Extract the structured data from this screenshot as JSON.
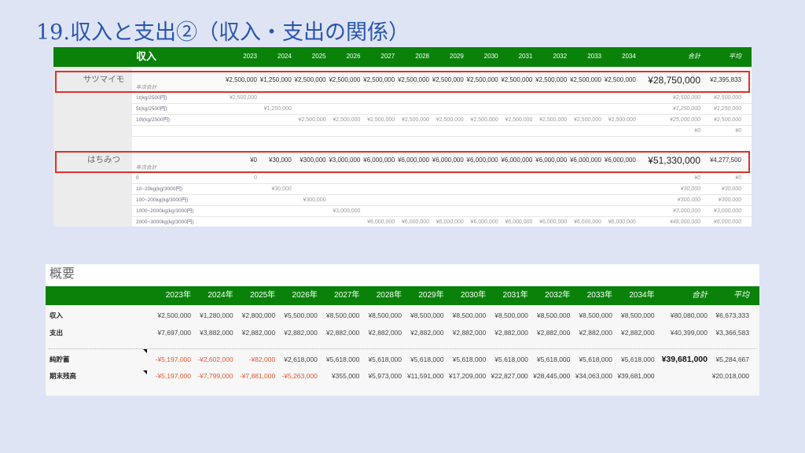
{
  "slide": {
    "title": "19.収入と支出②（収入・支出の関係）"
  },
  "colors": {
    "header_green": "#0a820a",
    "highlight_border": "#e0302a",
    "negative": "#e8582e",
    "title_blue": "#2856b0",
    "slide_background": "#dfe4f4"
  },
  "income_table": {
    "header_label": "収入",
    "years": [
      "2023",
      "2024",
      "2025",
      "2026",
      "2027",
      "2028",
      "2029",
      "2030",
      "2031",
      "2032",
      "2033",
      "2034"
    ],
    "total_label": "合計",
    "avg_label": "平均",
    "sections": [
      {
        "name": "サツマイモ",
        "summary": {
          "label": "年次合計",
          "values": [
            "¥2,500,000",
            "¥1,250,000",
            "¥2,500,000",
            "¥2,500,000",
            "¥2,500,000",
            "¥2,500,000",
            "¥2,500,000",
            "¥2,500,000",
            "¥2,500,000",
            "¥2,500,000",
            "¥2,500,000",
            "¥2,500,000"
          ],
          "total": "¥28,750,000",
          "avg": "¥2,395,833"
        },
        "rows": [
          {
            "label": "1t(kg/2500円)",
            "values": [
              "¥2,500,000",
              "",
              "",
              "",
              "",
              "",
              "",
              "",
              "",
              "",
              "",
              ""
            ],
            "total": "¥2,500,000",
            "avg": "¥2,500,000"
          },
          {
            "label": "5t(kg/2500円)",
            "values": [
              "",
              "¥1,250,000",
              "",
              "",
              "",
              "",
              "",
              "",
              "",
              "",
              "",
              ""
            ],
            "total": "¥1,250,000",
            "avg": "¥1,250,000"
          },
          {
            "label": "10t(kg/2500円)",
            "values": [
              "",
              "",
              "¥2,500,000",
              "¥2,500,000",
              "¥2,500,000",
              "¥2,500,000",
              "¥2,500,000",
              "¥2,500,000",
              "¥2,500,000",
              "¥2,500,000",
              "¥2,500,000",
              "¥2,500,000"
            ],
            "total": "¥25,000,000",
            "avg": "¥2,500,000"
          },
          {
            "label": "",
            "values": [
              "",
              "",
              "",
              "",
              "",
              "",
              "",
              "",
              "",
              "",
              "",
              ""
            ],
            "total": "¥0",
            "avg": "¥0"
          }
        ]
      },
      {
        "name": "はちみつ",
        "summary": {
          "label": "年次合計",
          "values": [
            "¥0",
            "¥30,000",
            "¥300,000",
            "¥3,000,000",
            "¥6,000,000",
            "¥6,000,000",
            "¥6,000,000",
            "¥6,000,000",
            "¥6,000,000",
            "¥6,000,000",
            "¥6,000,000",
            "¥6,000,000"
          ],
          "total": "¥51,330,000",
          "avg": "¥4,277,500"
        },
        "rows": [
          {
            "label": "0",
            "values": [
              "0",
              "",
              "",
              "",
              "",
              "",
              "",
              "",
              "",
              "",
              "",
              ""
            ],
            "total": "¥0",
            "avg": "¥0"
          },
          {
            "label": "10~20kg(kg/3000円)",
            "values": [
              "",
              "¥30,000",
              "",
              "",
              "",
              "",
              "",
              "",
              "",
              "",
              "",
              ""
            ],
            "total": "¥30,000",
            "avg": "¥30,000"
          },
          {
            "label": "100~200kg(kg/3000円)",
            "values": [
              "",
              "",
              "¥300,000",
              "",
              "",
              "",
              "",
              "",
              "",
              "",
              "",
              ""
            ],
            "total": "¥300,000",
            "avg": "¥300,000"
          },
          {
            "label": "1000~2000kg(kg/3000円)",
            "values": [
              "",
              "",
              "",
              "¥3,000,000",
              "",
              "",
              "",
              "",
              "",
              "",
              "",
              ""
            ],
            "total": "¥3,000,000",
            "avg": "¥3,000,000"
          },
          {
            "label": "2000~3000kg(kg/3000円)",
            "values": [
              "",
              "",
              "",
              "",
              "¥6,000,000",
              "¥6,000,000",
              "¥6,000,000",
              "¥6,000,000",
              "¥6,000,000",
              "¥6,000,000",
              "¥6,000,000",
              "¥6,000,000"
            ],
            "total": "¥48,000,000",
            "avg": "¥6,000,000"
          }
        ]
      }
    ]
  },
  "summary_table": {
    "title": "概要",
    "years": [
      "2023年",
      "2024年",
      "2025年",
      "2026年",
      "2027年",
      "2028年",
      "2029年",
      "2030年",
      "2031年",
      "2032年",
      "2033年",
      "2034年"
    ],
    "total_label": "合計",
    "avg_label": "平均",
    "rows": [
      {
        "label": "収入",
        "values": [
          "¥2,500,000",
          "¥1,280,000",
          "¥2,800,000",
          "¥5,500,000",
          "¥8,500,000",
          "¥8,500,000",
          "¥8,500,000",
          "¥8,500,000",
          "¥8,500,000",
          "¥8,500,000",
          "¥8,500,000",
          "¥8,500,000"
        ],
        "total": "¥80,080,000",
        "avg": "¥6,673,333"
      },
      {
        "label": "支出",
        "values": [
          "¥7,697,000",
          "¥3,882,000",
          "¥2,882,000",
          "¥2,882,000",
          "¥2,882,000",
          "¥2,882,000",
          "¥2,882,000",
          "¥2,882,000",
          "¥2,882,000",
          "¥2,882,000",
          "¥2,882,000",
          "¥2,882,000"
        ],
        "total": "¥40,399,000",
        "avg": "¥3,366,583"
      },
      {
        "label": "純貯蓄",
        "values": [
          "-¥5,197,000",
          "-¥2,602,000",
          "-¥82,000",
          "¥2,618,000",
          "¥5,618,000",
          "¥5,618,000",
          "¥5,618,000",
          "¥5,618,000",
          "¥5,618,000",
          "¥5,618,000",
          "¥5,618,000",
          "¥5,618,000"
        ],
        "total": "¥39,681,000",
        "avg": "¥5,284,667"
      },
      {
        "label": "期末残高",
        "values": [
          "-¥5,197,000",
          "-¥7,799,000",
          "-¥7,881,000",
          "-¥5,263,000",
          "¥355,000",
          "¥5,973,000",
          "¥11,591,000",
          "¥17,209,000",
          "¥22,827,000",
          "¥28,445,000",
          "¥34,063,000",
          "¥39,681,000"
        ],
        "total": "",
        "avg": "¥20,018,000"
      }
    ]
  }
}
